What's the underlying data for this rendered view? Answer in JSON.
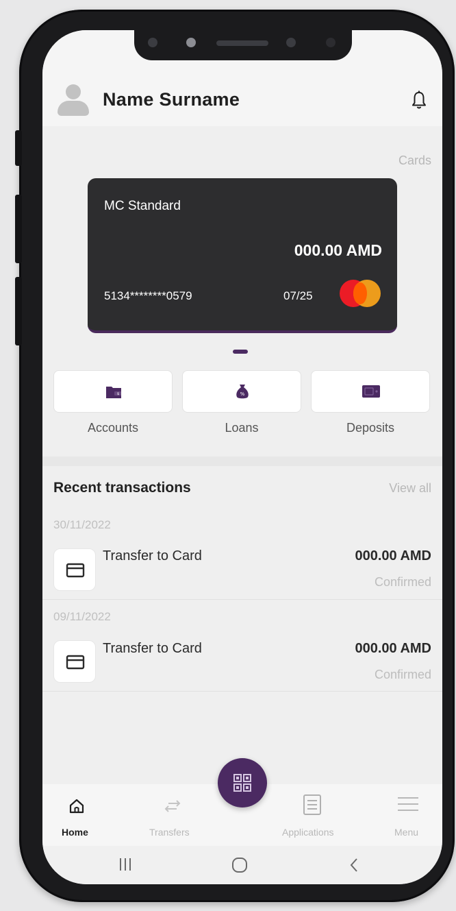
{
  "header": {
    "user_name": "Name Surname"
  },
  "cards": {
    "link_label": "Cards",
    "card": {
      "name": "MC Standard",
      "balance": "000.00 AMD",
      "number": "5134********0579",
      "expiry": "07/25"
    }
  },
  "quick_actions": [
    {
      "label": "Accounts",
      "icon": "wallet-icon"
    },
    {
      "label": "Loans",
      "icon": "money-bag-icon"
    },
    {
      "label": "Deposits",
      "icon": "safe-icon"
    }
  ],
  "transactions": {
    "title": "Recent transactions",
    "view_all": "View all",
    "groups": [
      {
        "date": "30/11/2022",
        "items": [
          {
            "title": "Transfer to Card",
            "amount": "000.00 AMD",
            "status": "Confirmed"
          }
        ]
      },
      {
        "date": "09/11/2022",
        "items": [
          {
            "title": "Transfer to Card",
            "amount": "000.00 AMD",
            "status": "Confirmed"
          }
        ]
      }
    ]
  },
  "tabbar": {
    "tabs": [
      {
        "label": "Home",
        "icon": "home-icon",
        "active": true
      },
      {
        "label": "Transfers",
        "icon": "transfer-arrows-icon",
        "active": false
      },
      {
        "label": "Applications",
        "icon": "document-icon",
        "active": false
      },
      {
        "label": "Menu",
        "icon": "menu-icon",
        "active": false
      }
    ],
    "center_action_icon": "qr-code-icon"
  },
  "colors": {
    "brand": "#4b2a62",
    "card_bg": "#2d2d2f",
    "screen_bg": "#efefef"
  }
}
